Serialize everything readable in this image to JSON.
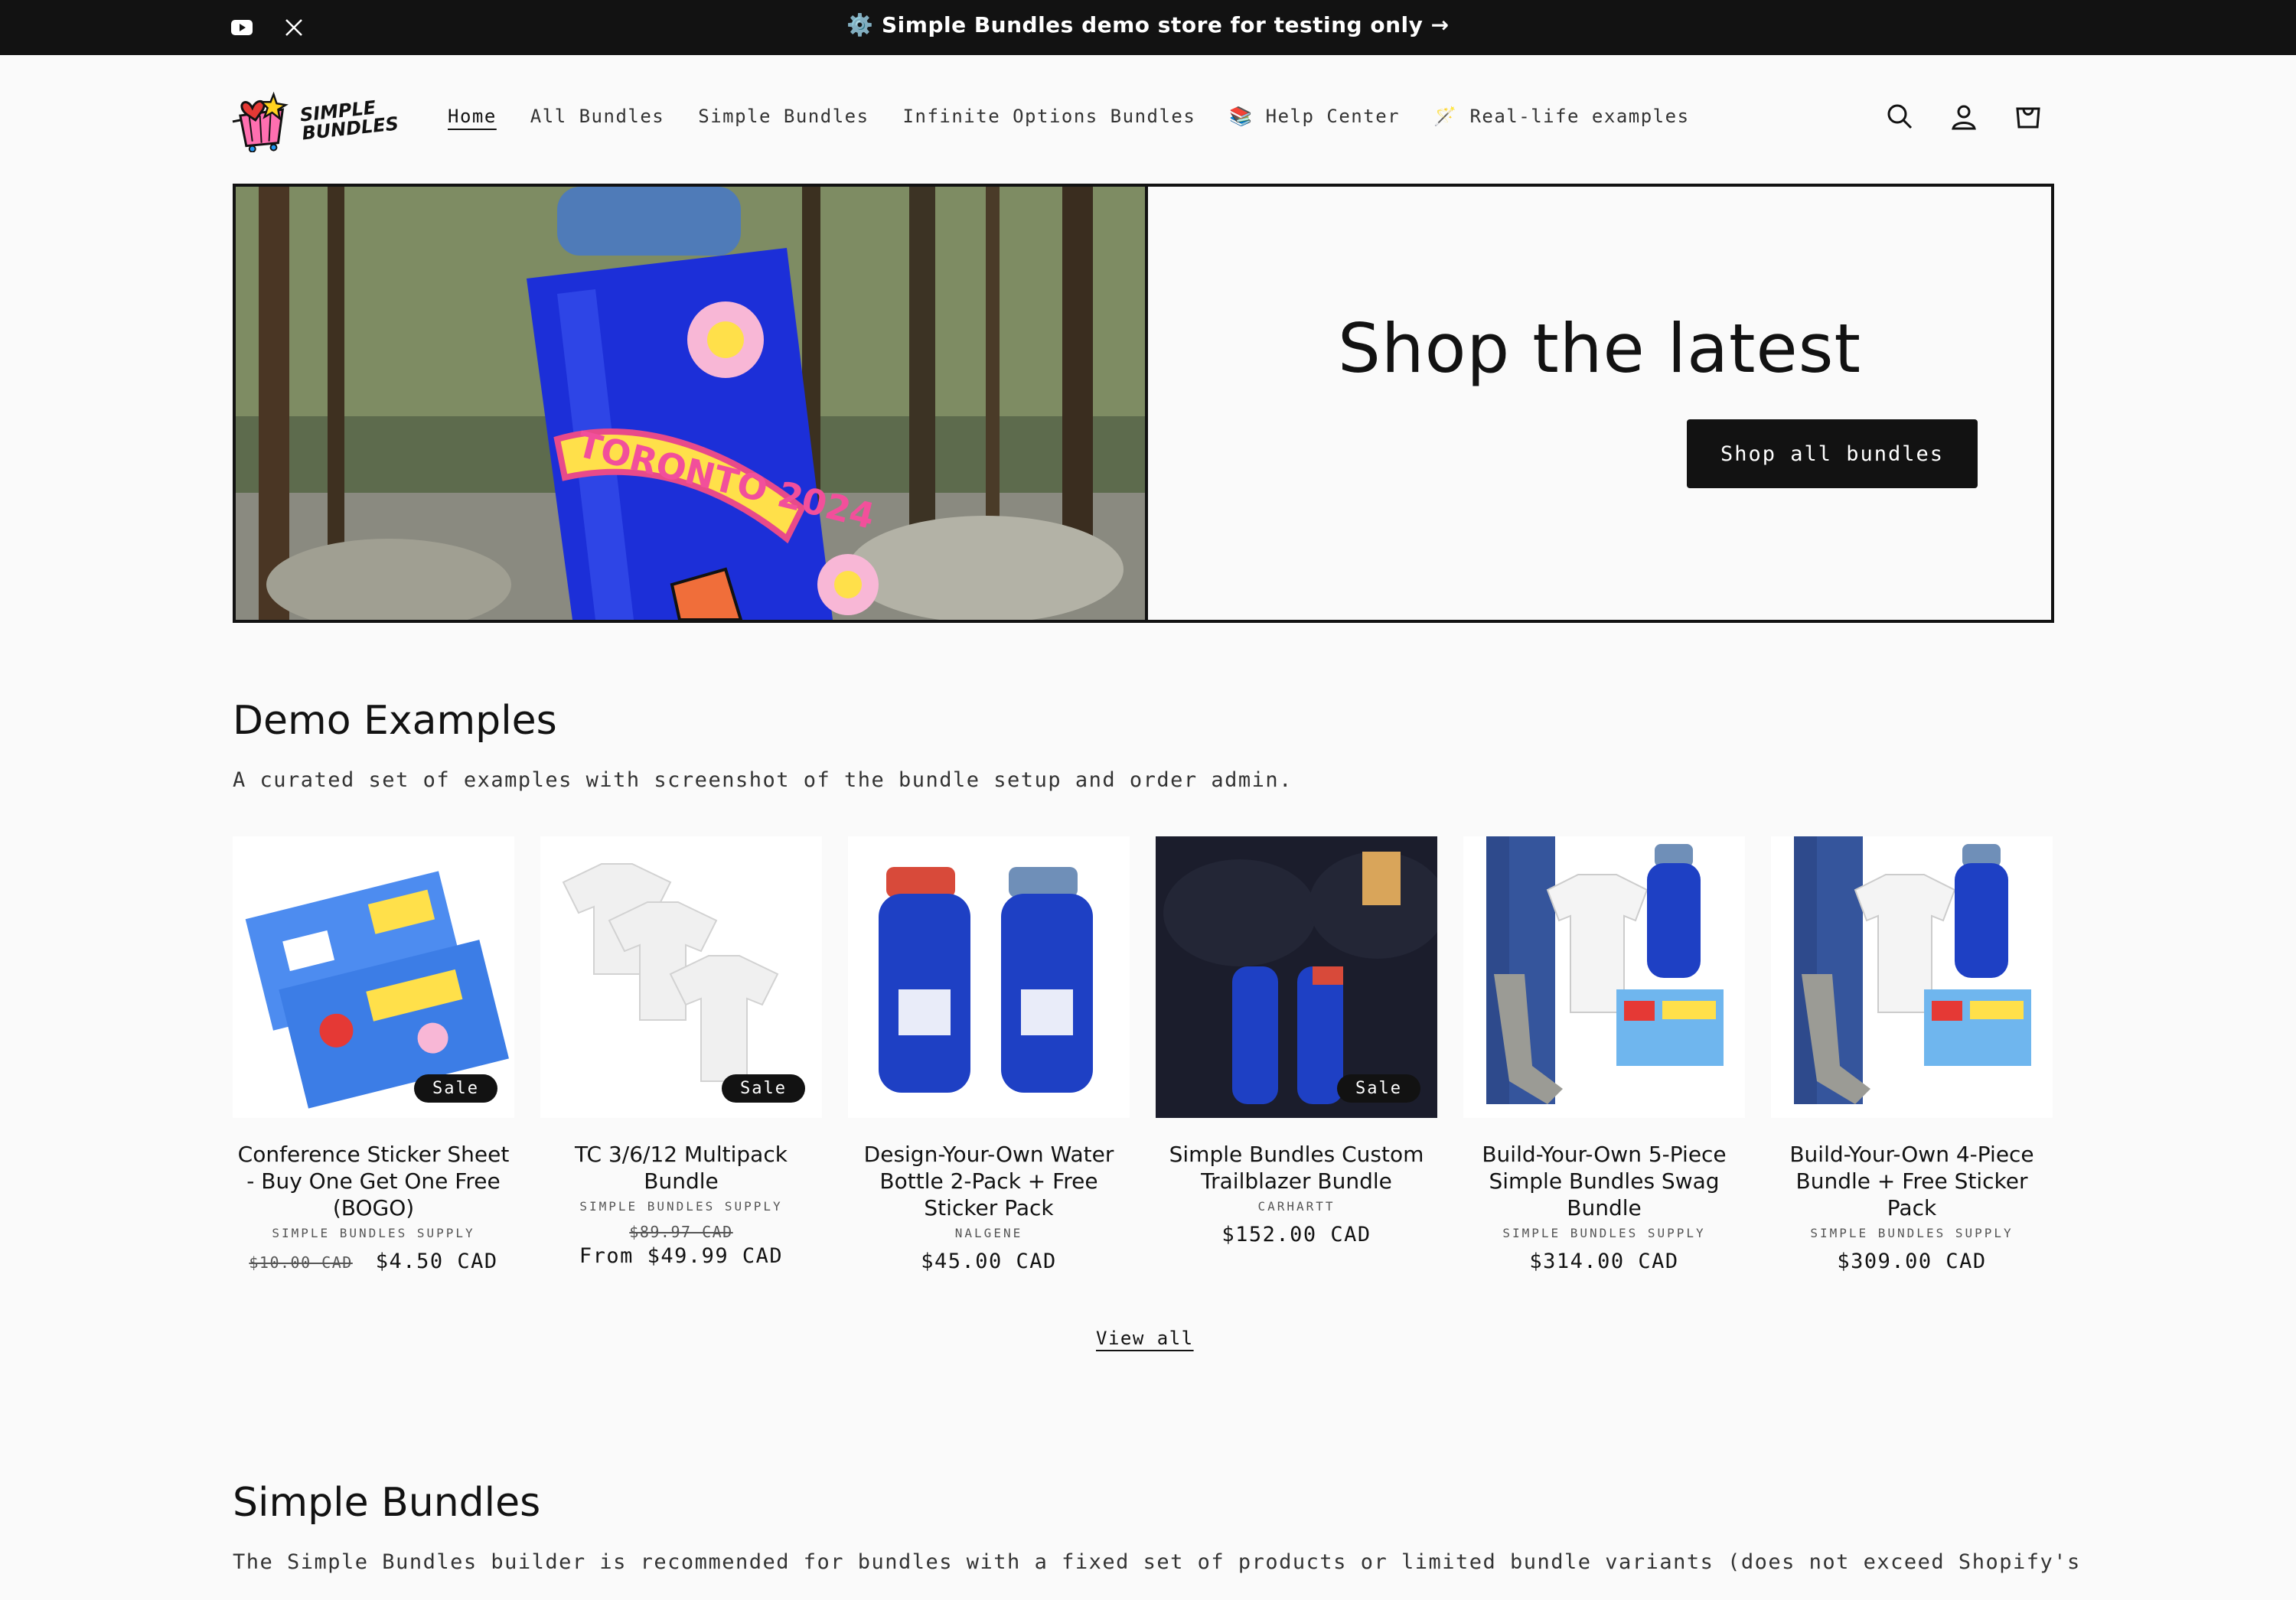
{
  "announcement": {
    "message": "⚙️ Simple Bundles demo store for testing only →",
    "social": [
      "youtube-icon",
      "x-icon"
    ]
  },
  "header": {
    "logo_text_line1": "SIMPLE",
    "logo_text_line2": "BUNDLES",
    "nav": [
      {
        "label": "Home",
        "active": true
      },
      {
        "label": "All Bundles"
      },
      {
        "label": "Simple Bundles"
      },
      {
        "label": "Infinite Options Bundles"
      },
      {
        "label": "📚 Help Center"
      },
      {
        "label": "🪄 Real-life examples"
      }
    ],
    "icons": [
      "search-icon",
      "account-icon",
      "cart-icon"
    ]
  },
  "hero": {
    "title": "Shop the latest",
    "button_label": "Shop all bundles",
    "photo_sticker_text": "TORONTO 2024"
  },
  "demo": {
    "title": "Demo Examples",
    "description": "A curated set of examples with screenshot of the bundle setup and order admin.",
    "products": [
      {
        "name": "Conference Sticker Sheet - Buy One Get One Free (BOGO)",
        "vendor": "SIMPLE BUNDLES SUPPLY",
        "old_price": "$10.00 CAD",
        "price": "$4.50 CAD",
        "badge": "Sale"
      },
      {
        "name": "TC 3/6/12 Multipack Bundle",
        "vendor": "SIMPLE BUNDLES SUPPLY",
        "old_price": "$89.97 CAD",
        "price": "From $49.99 CAD",
        "badge": "Sale"
      },
      {
        "name": "Design-Your-Own Water Bottle 2-Pack + Free Sticker Pack",
        "vendor": "NALGENE",
        "price": "$45.00 CAD"
      },
      {
        "name": "Simple Bundles Custom Trailblazer Bundle",
        "vendor": "CARHARTT",
        "price": "$152.00 CAD",
        "badge": "Sale"
      },
      {
        "name": "Build-Your-Own 5-Piece Simple Bundles Swag Bundle",
        "vendor": "SIMPLE BUNDLES SUPPLY",
        "price": "$314.00 CAD"
      },
      {
        "name": "Build-Your-Own 4-Piece Bundle + Free Sticker Pack",
        "vendor": "SIMPLE BUNDLES SUPPLY",
        "price": "$309.00 CAD"
      }
    ],
    "view_all": "View all"
  },
  "simple_bundles": {
    "title": "Simple Bundles",
    "description": "The Simple Bundles builder is recommended for bundles with a fixed set of products or limited bundle variants (does not exceed Shopify's"
  }
}
